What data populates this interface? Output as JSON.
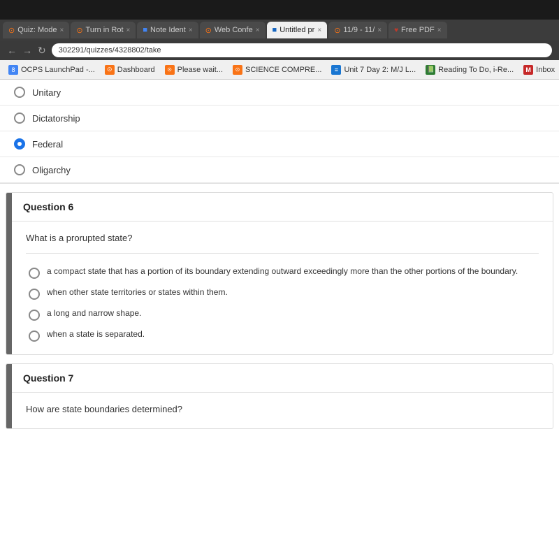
{
  "os_bar": {
    "label": ""
  },
  "browser": {
    "tabs": [
      {
        "id": "quiz-mode",
        "label": "Quiz: Mode",
        "active": false,
        "icon_color": "#f97316",
        "icon_type": "spinner"
      },
      {
        "id": "turn-in-rot",
        "label": "Turn in Rot",
        "active": false,
        "icon_color": "#f97316",
        "icon_type": "spinner"
      },
      {
        "id": "note-ident",
        "label": "Note Ident",
        "active": false,
        "icon_color": "#4285f4",
        "icon_type": "square"
      },
      {
        "id": "web-conf",
        "label": "Web Confe",
        "active": false,
        "icon_color": "#f97316",
        "icon_type": "spinner"
      },
      {
        "id": "untitled",
        "label": "Untitled pr",
        "active": false,
        "icon_color": "#1565c0",
        "icon_type": "square"
      },
      {
        "id": "11-9",
        "label": "11/9 - 11/",
        "active": false,
        "icon_color": "#f97316",
        "icon_type": "spinner"
      },
      {
        "id": "free-pdf",
        "label": "Free PDF",
        "active": false,
        "icon_color": "#c0392b",
        "icon_type": "heart"
      }
    ],
    "url": "302291/quizzes/4328802/take"
  },
  "bookmarks": [
    {
      "id": "ocps",
      "label": "OCPS LaunchPad -...",
      "icon_color": "#4285f4",
      "icon_char": "8"
    },
    {
      "id": "dashboard",
      "label": "Dashboard",
      "icon_color": "#f97316",
      "icon_char": "⊙"
    },
    {
      "id": "please-wait",
      "label": "Please wait...",
      "icon_color": "#f97316",
      "icon_char": "⊙"
    },
    {
      "id": "science-compre",
      "label": "SCIENCE COMPRE...",
      "icon_color": "#f97316",
      "icon_char": "⊙"
    },
    {
      "id": "unit7",
      "label": "Unit 7 Day 2: M/J L...",
      "icon_color": "#1976d2",
      "icon_char": "≡"
    },
    {
      "id": "reading",
      "label": "Reading To Do, i-Re...",
      "icon_color": "#2e7d32",
      "icon_char": "📖"
    },
    {
      "id": "inbox",
      "label": "Inbox",
      "icon_color": "#c62828",
      "icon_char": "M"
    }
  ],
  "page": {
    "prev_question_options": [
      {
        "id": "unitary",
        "label": "Unitary",
        "selected": false
      },
      {
        "id": "dictatorship",
        "label": "Dictatorship",
        "selected": false
      },
      {
        "id": "federal",
        "label": "Federal",
        "selected": true
      },
      {
        "id": "oligarchy",
        "label": "Oligarchy",
        "selected": false
      }
    ],
    "question6": {
      "number": "Question 6",
      "text": "What is a prorupted state?",
      "options": [
        {
          "id": "opt-a",
          "label": "a compact state that has a portion of its boundary extending outward exceedingly more than the other portions of the boundary."
        },
        {
          "id": "opt-b",
          "label": "when other state territories or states within them."
        },
        {
          "id": "opt-c",
          "label": "a long and narrow shape."
        },
        {
          "id": "opt-d",
          "label": "when a state is separated."
        }
      ]
    },
    "question7": {
      "number": "Question 7",
      "text": "How are state boundaries determined?"
    }
  }
}
